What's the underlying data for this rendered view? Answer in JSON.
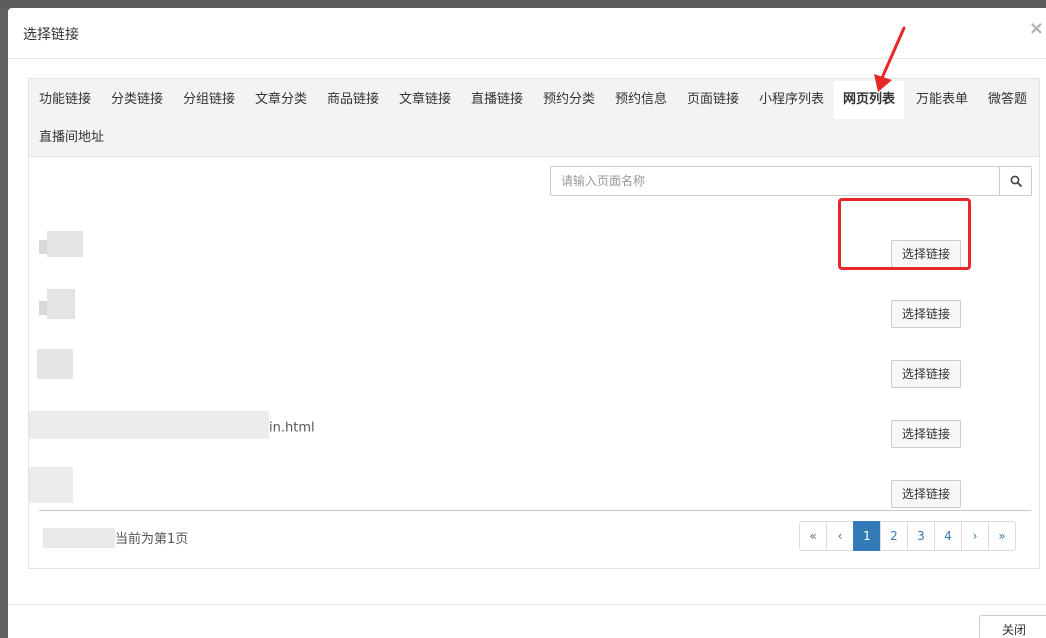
{
  "dialog": {
    "title": "选择链接",
    "close_icon": "close-icon",
    "footer_close_label": "关闭"
  },
  "tabs": [
    {
      "label": "功能链接"
    },
    {
      "label": "分类链接"
    },
    {
      "label": "分组链接"
    },
    {
      "label": "文章分类"
    },
    {
      "label": "商品链接"
    },
    {
      "label": "文章链接"
    },
    {
      "label": "直播链接"
    },
    {
      "label": "预约分类"
    },
    {
      "label": "预约信息"
    },
    {
      "label": "页面链接"
    },
    {
      "label": "小程序列表"
    },
    {
      "label": "网页列表",
      "active": true
    },
    {
      "label": "万能表单"
    },
    {
      "label": "微答题"
    },
    {
      "label": "直播间地址"
    }
  ],
  "search": {
    "placeholder": "请输入页面名称",
    "icon": "search-icon"
  },
  "rows": [
    {
      "title": "",
      "button": "选择链接"
    },
    {
      "title": "",
      "button": "选择链接"
    },
    {
      "title": "",
      "button": "选择链接"
    },
    {
      "title": "in.html",
      "button": "选择链接"
    },
    {
      "title": "",
      "button": "选择链接"
    }
  ],
  "page_info": "当前为第1页",
  "pagination": {
    "first": "«",
    "prev": "‹",
    "pages": [
      "1",
      "2",
      "3",
      "4"
    ],
    "current": "1",
    "next": "›",
    "last": "»"
  },
  "colors": {
    "accent": "#337ab7",
    "annotation": "#e8272a",
    "tab_bar": "#f3f3f3"
  }
}
